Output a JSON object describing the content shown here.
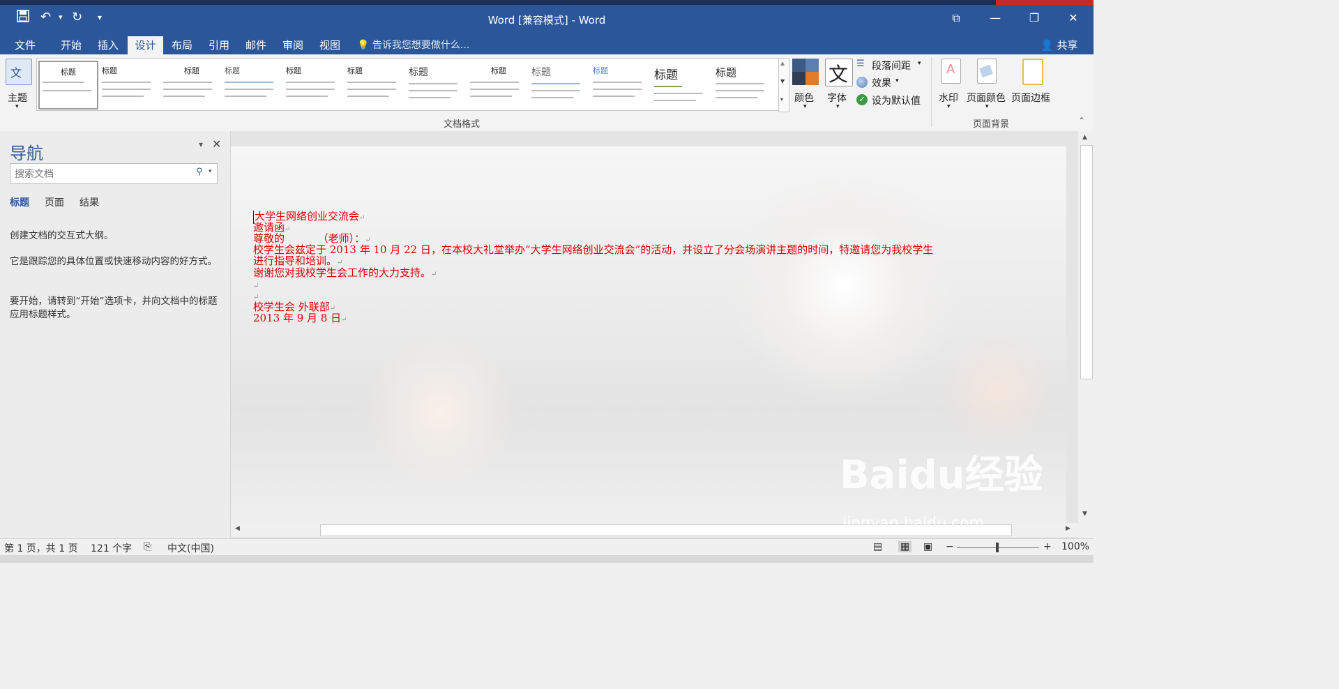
{
  "titlebar": {
    "title": "Word [兼容模式] - Word",
    "save_icon": "save-icon",
    "undo_icon": "undo-icon",
    "redo_icon": "redo-icon"
  },
  "tabs": [
    "文件",
    "开始",
    "插入",
    "设计",
    "布局",
    "引用",
    "邮件",
    "审阅",
    "视图"
  ],
  "active_tab": "设计",
  "tell_me": "告诉我您想要做什么...",
  "share": "共享",
  "ribbon": {
    "theme_label": "主题",
    "gallery_label": "文档格式",
    "gallery_titles": [
      "标题",
      "标题",
      "标题",
      "标题",
      "标题",
      "标题",
      "标题",
      "标题",
      "标题",
      "标题",
      "标题",
      "标题"
    ],
    "colors_label": "颜色",
    "fonts_label": "字体",
    "fonts_glyph": "文",
    "paragraph_spacing": "段落间距",
    "effects": "效果",
    "set_default": "设为默认值",
    "watermark": "水印",
    "page_color": "页面颜色",
    "page_border": "页面边框",
    "page_bg_label": "页面背景"
  },
  "nav": {
    "title": "导航",
    "search_placeholder": "搜索文档",
    "tabs": [
      "标题",
      "页面",
      "结果"
    ],
    "text1": "创建文档的交互式大纲。",
    "text2": "它是跟踪您的具体位置或快速移动内容的好方式。",
    "text3": "要开始，请转到“开始”选项卡，并向文档中的标题应用标题样式。"
  },
  "document": {
    "lines": [
      "大学生网络创业交流会",
      "邀请函",
      "尊敬的          （老师）：",
      "校学生会兹定于 2013 年 10 月 22 日，在本校大礼堂举办“大学生网络创业交流会”的活动，并设立了分会场演讲主题的时间，特邀请您为我校学生",
      "进行指导和培训。",
      "谢谢您对我校学生会工作的大力支持。",
      "",
      "",
      "校学生会 外联部",
      "2013 年 9 月 8 日"
    ],
    "text_color": "#e00000"
  },
  "status": {
    "page": "第 1 页，共 1 页",
    "words": "121 个字",
    "language": "中文(中国)",
    "zoom": "100%"
  },
  "watermark": {
    "brand": "Baidu经验",
    "url": "jingyan.baidu.com"
  }
}
